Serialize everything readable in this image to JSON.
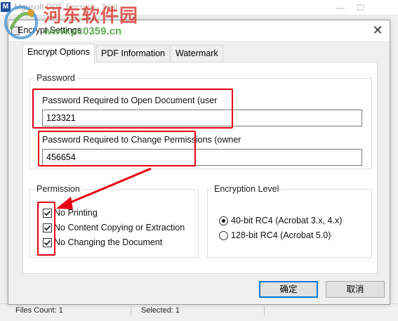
{
  "main_window": {
    "title": "Mgosoft PDF Encrypt - Trial",
    "app_icon_text": "M",
    "minimize_glyph": "—",
    "maximize_glyph": "☐",
    "status": {
      "files_count": "Files Count: 1",
      "selected": "Selected: 1"
    }
  },
  "watermark": {
    "cn_text": "河东软件园",
    "url": "www.pc0359.cn"
  },
  "dialog": {
    "title": "Encrypt Settings",
    "close_glyph": "✕",
    "tabs": [
      {
        "label": "Encrypt Options",
        "active": true
      },
      {
        "label": "PDF Information",
        "active": false
      },
      {
        "label": "Watermark",
        "active": false
      }
    ],
    "password_group": {
      "legend": "Password",
      "user_label": "Password Required to Open Document (user",
      "user_value": "123321",
      "owner_label": "Password Required to Change Permissions (owner",
      "owner_value": "456654"
    },
    "permission_group": {
      "legend": "Permission",
      "items": [
        {
          "label": "No Printing",
          "checked": true
        },
        {
          "label": "No Content Copying or Extraction",
          "checked": true
        },
        {
          "label": "No Changing the Document",
          "checked": true
        }
      ]
    },
    "encryption_group": {
      "legend": "Encryption Level",
      "options": [
        {
          "label": "40-bit RC4 (Acrobat 3.x, 4.x)",
          "selected": true
        },
        {
          "label": "128-bit RC4 (Acrobat 5.0)",
          "selected": false
        }
      ]
    },
    "ok_label": "确定",
    "cancel_label": "取消"
  },
  "colors": {
    "highlight": "#e60012",
    "accent": "#0078d7"
  }
}
